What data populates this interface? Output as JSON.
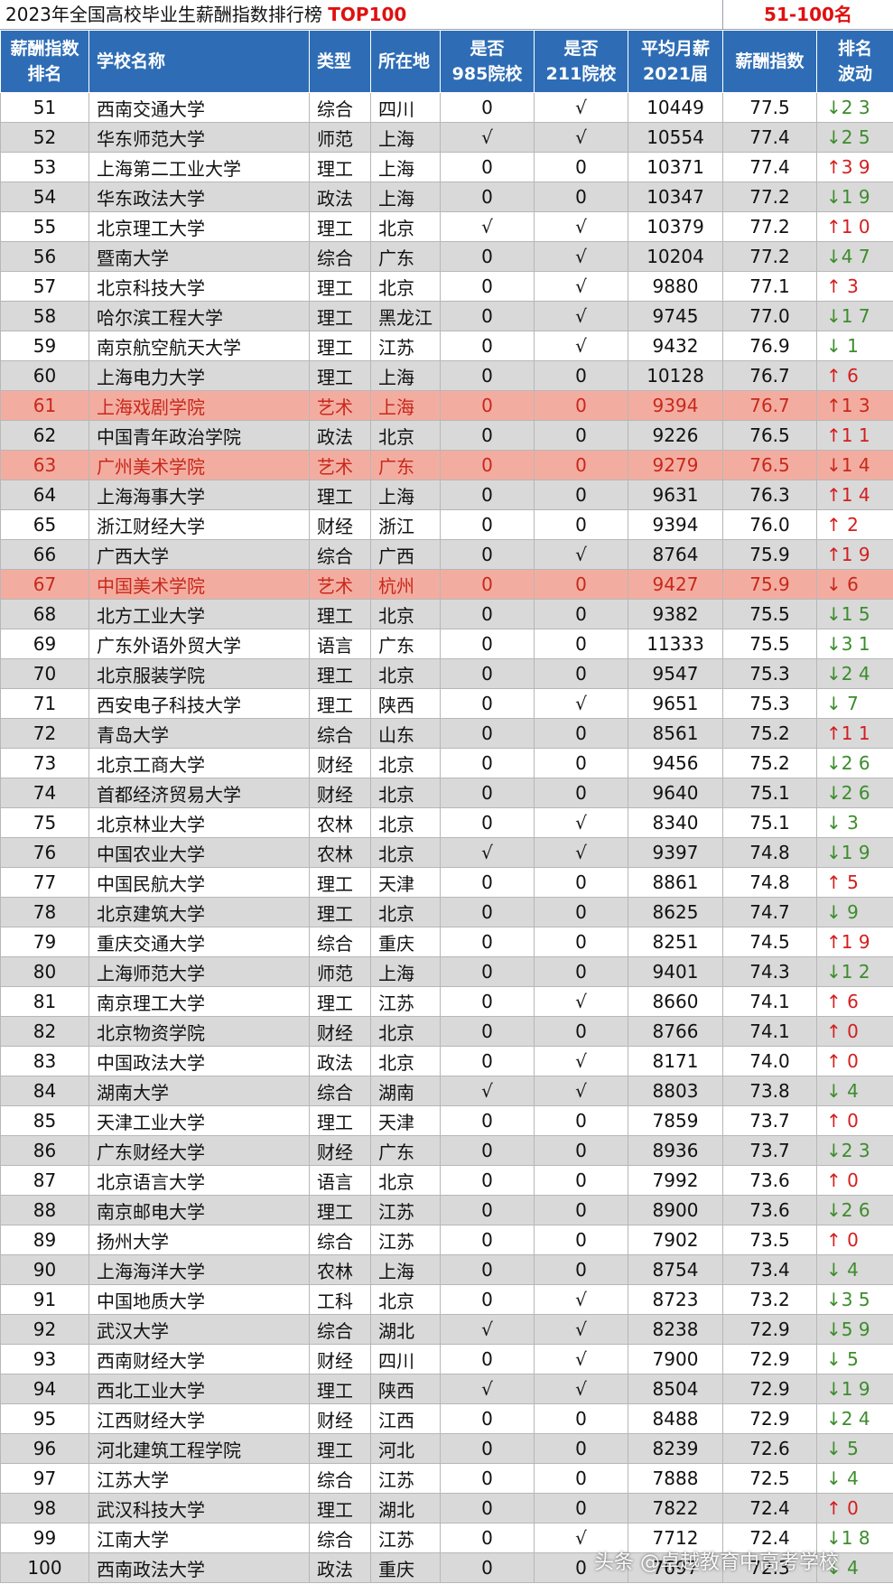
{
  "title": "2023年全国高校毕业生薪酬指数排行榜",
  "title_tag": "TOP100",
  "range_label": "51-100名",
  "columns": [
    "薪酬指数\n排名",
    "学校名称",
    "类型",
    "所在地",
    "是否\n985院校",
    "是否\n211院校",
    "平均月薪\n2021届",
    "薪酬指数",
    "排名\n波动"
  ],
  "colors": {
    "header_bg": "#2e6db5",
    "highlight_bg": "#f3ada0",
    "highlight_text": "#c8281c",
    "up": "#d41e1e",
    "down": "#3c8c2c"
  },
  "rows": [
    {
      "rank": "51",
      "name": "西南交通大学",
      "type": "综合",
      "loc": "四川",
      "is985": "0",
      "is211": "√",
      "salary": "10449",
      "index": "77.5",
      "trend": "↓2 3"
    },
    {
      "rank": "52",
      "name": "华东师范大学",
      "type": "师范",
      "loc": "上海",
      "is985": "√",
      "is211": "√",
      "salary": "10554",
      "index": "77.4",
      "trend": "↓2 5"
    },
    {
      "rank": "53",
      "name": "上海第二工业大学",
      "type": "理工",
      "loc": "上海",
      "is985": "0",
      "is211": "0",
      "salary": "10371",
      "index": "77.4",
      "trend": "↑3 9"
    },
    {
      "rank": "54",
      "name": "华东政法大学",
      "type": "政法",
      "loc": "上海",
      "is985": "0",
      "is211": "0",
      "salary": "10347",
      "index": "77.2",
      "trend": "↓1 9"
    },
    {
      "rank": "55",
      "name": "北京理工大学",
      "type": "理工",
      "loc": "北京",
      "is985": "√",
      "is211": "√",
      "salary": "10379",
      "index": "77.2",
      "trend": "↑1 0"
    },
    {
      "rank": "56",
      "name": "暨南大学",
      "type": "综合",
      "loc": "广东",
      "is985": "0",
      "is211": "√",
      "salary": "10204",
      "index": "77.2",
      "trend": "↓4 7"
    },
    {
      "rank": "57",
      "name": "北京科技大学",
      "type": "理工",
      "loc": "北京",
      "is985": "0",
      "is211": "√",
      "salary": "9880",
      "index": "77.1",
      "trend": "↑ 3"
    },
    {
      "rank": "58",
      "name": "哈尔滨工程大学",
      "type": "理工",
      "loc": "黑龙江",
      "is985": "0",
      "is211": "√",
      "salary": "9745",
      "index": "77.0",
      "trend": "↓1 7"
    },
    {
      "rank": "59",
      "name": "南京航空航天大学",
      "type": "理工",
      "loc": "江苏",
      "is985": "0",
      "is211": "√",
      "salary": "9432",
      "index": "76.9",
      "trend": "↓ 1"
    },
    {
      "rank": "60",
      "name": "上海电力大学",
      "type": "理工",
      "loc": "上海",
      "is985": "0",
      "is211": "0",
      "salary": "10128",
      "index": "76.7",
      "trend": "↑ 6"
    },
    {
      "rank": "61",
      "name": "上海戏剧学院",
      "type": "艺术",
      "loc": "上海",
      "is985": "0",
      "is211": "0",
      "salary": "9394",
      "index": "76.7",
      "trend": "↑1 3",
      "hl": true
    },
    {
      "rank": "62",
      "name": "中国青年政治学院",
      "type": "政法",
      "loc": "北京",
      "is985": "0",
      "is211": "0",
      "salary": "9226",
      "index": "76.5",
      "trend": "↑1 1"
    },
    {
      "rank": "63",
      "name": "广州美术学院",
      "type": "艺术",
      "loc": "广东",
      "is985": "0",
      "is211": "0",
      "salary": "9279",
      "index": "76.5",
      "trend": "↓1 4",
      "hl": true
    },
    {
      "rank": "64",
      "name": "上海海事大学",
      "type": "理工",
      "loc": "上海",
      "is985": "0",
      "is211": "0",
      "salary": "9631",
      "index": "76.3",
      "trend": "↑1 4"
    },
    {
      "rank": "65",
      "name": "浙江财经大学",
      "type": "财经",
      "loc": "浙江",
      "is985": "0",
      "is211": "0",
      "salary": "9394",
      "index": "76.0",
      "trend": "↑ 2"
    },
    {
      "rank": "66",
      "name": "广西大学",
      "type": "综合",
      "loc": "广西",
      "is985": "0",
      "is211": "√",
      "salary": "8764",
      "index": "75.9",
      "trend": "↑1 9"
    },
    {
      "rank": "67",
      "name": "中国美术学院",
      "type": "艺术",
      "loc": "杭州",
      "is985": "0",
      "is211": "0",
      "salary": "9427",
      "index": "75.9",
      "trend": "↓ 6",
      "hl": true
    },
    {
      "rank": "68",
      "name": "北方工业大学",
      "type": "理工",
      "loc": "北京",
      "is985": "0",
      "is211": "0",
      "salary": "9382",
      "index": "75.5",
      "trend": "↓1 5"
    },
    {
      "rank": "69",
      "name": "广东外语外贸大学",
      "type": "语言",
      "loc": "广东",
      "is985": "0",
      "is211": "0",
      "salary": "11333",
      "index": "75.5",
      "trend": "↓3 1"
    },
    {
      "rank": "70",
      "name": "北京服装学院",
      "type": "理工",
      "loc": "北京",
      "is985": "0",
      "is211": "0",
      "salary": "9547",
      "index": "75.3",
      "trend": "↓2 4"
    },
    {
      "rank": "71",
      "name": "西安电子科技大学",
      "type": "理工",
      "loc": "陕西",
      "is985": "0",
      "is211": "√",
      "salary": "9651",
      "index": "75.3",
      "trend": "↓ 7"
    },
    {
      "rank": "72",
      "name": "青岛大学",
      "type": "综合",
      "loc": "山东",
      "is985": "0",
      "is211": "0",
      "salary": "8561",
      "index": "75.2",
      "trend": "↑1 1"
    },
    {
      "rank": "73",
      "name": "北京工商大学",
      "type": "财经",
      "loc": "北京",
      "is985": "0",
      "is211": "0",
      "salary": "9456",
      "index": "75.2",
      "trend": "↓2 6"
    },
    {
      "rank": "74",
      "name": "首都经济贸易大学",
      "type": "财经",
      "loc": "北京",
      "is985": "0",
      "is211": "0",
      "salary": "9640",
      "index": "75.1",
      "trend": "↓2 6"
    },
    {
      "rank": "75",
      "name": "北京林业大学",
      "type": "农林",
      "loc": "北京",
      "is985": "0",
      "is211": "√",
      "salary": "8340",
      "index": "75.1",
      "trend": "↓ 3"
    },
    {
      "rank": "76",
      "name": "中国农业大学",
      "type": "农林",
      "loc": "北京",
      "is985": "√",
      "is211": "√",
      "salary": "9397",
      "index": "74.8",
      "trend": "↓1 9"
    },
    {
      "rank": "77",
      "name": "中国民航大学",
      "type": "理工",
      "loc": "天津",
      "is985": "0",
      "is211": "0",
      "salary": "8861",
      "index": "74.8",
      "trend": "↑ 5"
    },
    {
      "rank": "78",
      "name": "北京建筑大学",
      "type": "理工",
      "loc": "北京",
      "is985": "0",
      "is211": "0",
      "salary": "8625",
      "index": "74.7",
      "trend": "↓ 9"
    },
    {
      "rank": "79",
      "name": "重庆交通大学",
      "type": "综合",
      "loc": "重庆",
      "is985": "0",
      "is211": "0",
      "salary": "8251",
      "index": "74.5",
      "trend": "↑1 9"
    },
    {
      "rank": "80",
      "name": "上海师范大学",
      "type": "师范",
      "loc": "上海",
      "is985": "0",
      "is211": "0",
      "salary": "9401",
      "index": "74.3",
      "trend": "↓1 2"
    },
    {
      "rank": "81",
      "name": "南京理工大学",
      "type": "理工",
      "loc": "江苏",
      "is985": "0",
      "is211": "√",
      "salary": "8660",
      "index": "74.1",
      "trend": "↑ 6"
    },
    {
      "rank": "82",
      "name": "北京物资学院",
      "type": "财经",
      "loc": "北京",
      "is985": "0",
      "is211": "0",
      "salary": "8766",
      "index": "74.1",
      "trend": "↑ 0"
    },
    {
      "rank": "83",
      "name": "中国政法大学",
      "type": "政法",
      "loc": "北京",
      "is985": "0",
      "is211": "√",
      "salary": "8171",
      "index": "74.0",
      "trend": "↑ 0"
    },
    {
      "rank": "84",
      "name": "湖南大学",
      "type": "综合",
      "loc": "湖南",
      "is985": "√",
      "is211": "√",
      "salary": "8803",
      "index": "73.8",
      "trend": "↓ 4"
    },
    {
      "rank": "85",
      "name": "天津工业大学",
      "type": "理工",
      "loc": "天津",
      "is985": "0",
      "is211": "0",
      "salary": "7859",
      "index": "73.7",
      "trend": "↑ 0"
    },
    {
      "rank": "86",
      "name": "广东财经大学",
      "type": "财经",
      "loc": "广东",
      "is985": "0",
      "is211": "0",
      "salary": "8936",
      "index": "73.7",
      "trend": "↓2 3"
    },
    {
      "rank": "87",
      "name": "北京语言大学",
      "type": "语言",
      "loc": "北京",
      "is985": "0",
      "is211": "0",
      "salary": "7992",
      "index": "73.6",
      "trend": "↑ 0"
    },
    {
      "rank": "88",
      "name": "南京邮电大学",
      "type": "理工",
      "loc": "江苏",
      "is985": "0",
      "is211": "0",
      "salary": "8900",
      "index": "73.6",
      "trend": "↓2 6"
    },
    {
      "rank": "89",
      "name": "扬州大学",
      "type": "综合",
      "loc": "江苏",
      "is985": "0",
      "is211": "0",
      "salary": "7902",
      "index": "73.5",
      "trend": "↑ 0"
    },
    {
      "rank": "90",
      "name": "上海海洋大学",
      "type": "农林",
      "loc": "上海",
      "is985": "0",
      "is211": "0",
      "salary": "8754",
      "index": "73.4",
      "trend": "↓ 4"
    },
    {
      "rank": "91",
      "name": "中国地质大学",
      "type": "工科",
      "loc": "北京",
      "is985": "0",
      "is211": "√",
      "salary": "8723",
      "index": "73.2",
      "trend": "↓3 5"
    },
    {
      "rank": "92",
      "name": "武汉大学",
      "type": "综合",
      "loc": "湖北",
      "is985": "√",
      "is211": "√",
      "salary": "8238",
      "index": "72.9",
      "trend": "↓5 9"
    },
    {
      "rank": "93",
      "name": "西南财经大学",
      "type": "财经",
      "loc": "四川",
      "is985": "0",
      "is211": "√",
      "salary": "7900",
      "index": "72.9",
      "trend": "↓ 5"
    },
    {
      "rank": "94",
      "name": "西北工业大学",
      "type": "理工",
      "loc": "陕西",
      "is985": "√",
      "is211": "√",
      "salary": "8504",
      "index": "72.9",
      "trend": "↓1 9"
    },
    {
      "rank": "95",
      "name": "江西财经大学",
      "type": "财经",
      "loc": "江西",
      "is985": "0",
      "is211": "0",
      "salary": "8488",
      "index": "72.9",
      "trend": "↓2 4"
    },
    {
      "rank": "96",
      "name": "河北建筑工程学院",
      "type": "理工",
      "loc": "河北",
      "is985": "0",
      "is211": "0",
      "salary": "8239",
      "index": "72.6",
      "trend": "↓ 5"
    },
    {
      "rank": "97",
      "name": "江苏大学",
      "type": "综合",
      "loc": "江苏",
      "is985": "0",
      "is211": "0",
      "salary": "7888",
      "index": "72.5",
      "trend": "↓ 4"
    },
    {
      "rank": "98",
      "name": "武汉科技大学",
      "type": "理工",
      "loc": "湖北",
      "is985": "0",
      "is211": "0",
      "salary": "7822",
      "index": "72.4",
      "trend": "↑ 0"
    },
    {
      "rank": "99",
      "name": "江南大学",
      "type": "综合",
      "loc": "江苏",
      "is985": "0",
      "is211": "√",
      "salary": "7712",
      "index": "72.4",
      "trend": "↓1 8"
    },
    {
      "rank": "100",
      "name": "西南政法大学",
      "type": "政法",
      "loc": "重庆",
      "is985": "0",
      "is211": "0",
      "salary": "7697",
      "index": "72.3",
      "trend": "↓ 4"
    }
  ],
  "watermark": "头条 @卓越教育中高考学校"
}
